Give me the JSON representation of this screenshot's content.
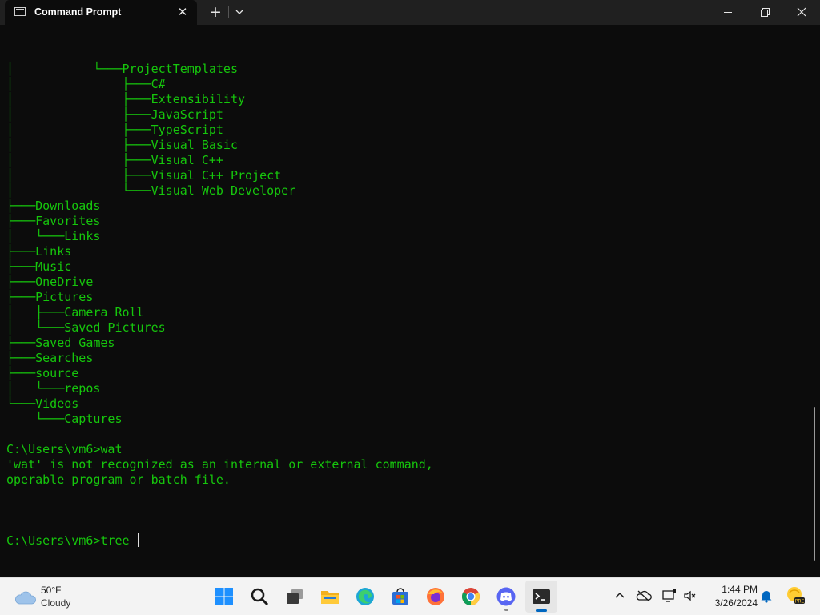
{
  "window": {
    "tab_title": "Command Prompt",
    "new_tab_label": "+",
    "close_tab_label": "✕"
  },
  "terminal": {
    "lines": [
      "│           └───ProjectTemplates",
      "│               ├───C#",
      "│               ├───Extensibility",
      "│               ├───JavaScript",
      "│               ├───TypeScript",
      "│               ├───Visual Basic",
      "│               ├───Visual C++",
      "│               ├───Visual C++ Project",
      "│               └───Visual Web Developer",
      "├───Downloads",
      "├───Favorites",
      "│   └───Links",
      "├───Links",
      "├───Music",
      "├───OneDrive",
      "├───Pictures",
      "│   ├───Camera Roll",
      "│   └───Saved Pictures",
      "├───Saved Games",
      "├───Searches",
      "├───source",
      "│   └───repos",
      "└───Videos",
      "    └───Captures",
      "",
      "C:\\Users\\vm6>wat",
      "'wat' is not recognized as an internal or external command,",
      "operable program or batch file.",
      ""
    ],
    "prompt": "C:\\Users\\vm6>",
    "input": "tree "
  },
  "taskbar": {
    "weather_temp": "50°F",
    "weather_condition": "Cloudy",
    "clock_time": "1:44 PM",
    "clock_date": "3/26/2024",
    "apps": [
      "start-icon",
      "search-icon",
      "task-view-icon",
      "file-explorer-icon",
      "edge-icon",
      "microsoft-store-icon",
      "firefox-icon",
      "chrome-icon",
      "discord-icon",
      "terminal-icon"
    ],
    "tray": [
      "chevron-up-icon",
      "onedrive-icon",
      "display-icon",
      "speaker-muted-icon",
      "notification-bell-icon",
      "copilot-pre-icon"
    ],
    "accent": "#0067c0",
    "terminal_text_color": "#16c60c"
  }
}
